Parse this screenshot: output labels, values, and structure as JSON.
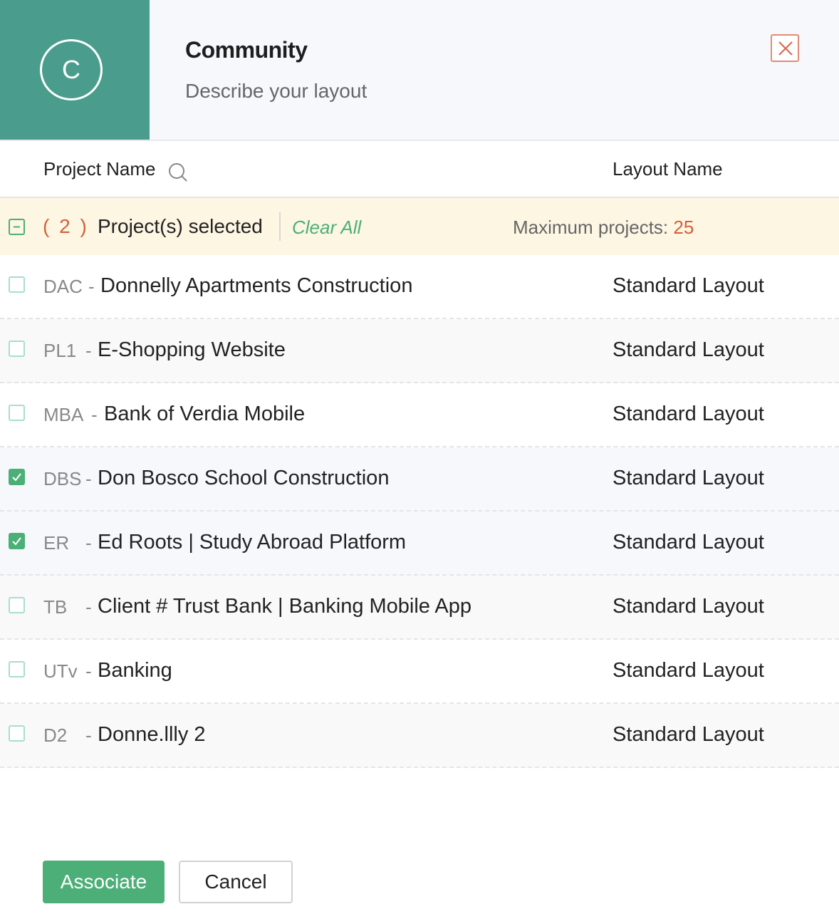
{
  "dialog": {
    "avatar_letter": "C",
    "title": "Community",
    "subtitle": "Describe your layout"
  },
  "columns": {
    "project_name": "Project Name",
    "layout_name": "Layout Name"
  },
  "selection": {
    "count": "( 2 )",
    "label": "Project(s) selected",
    "clear_all": "Clear All",
    "max_label": "Maximum projects: ",
    "max_value": "25"
  },
  "rows": [
    {
      "code": "DAC",
      "name": "Donnelly Apartments Construction",
      "layout": "Standard Layout",
      "checked": false
    },
    {
      "code": "PL1",
      "name": "E-Shopping Website",
      "layout": "Standard Layout",
      "checked": false
    },
    {
      "code": "MBA",
      "name": "Bank of Verdia Mobile",
      "layout": "Standard Layout",
      "checked": false
    },
    {
      "code": "DBS",
      "name": "Don Bosco School Construction",
      "layout": "Standard Layout",
      "checked": true
    },
    {
      "code": "ER",
      "name": "Ed Roots | Study Abroad Platform",
      "layout": "Standard Layout",
      "checked": true
    },
    {
      "code": "TB",
      "name": "Client # Trust Bank | Banking Mobile App",
      "layout": "Standard Layout",
      "checked": false
    },
    {
      "code": "UTv",
      "name": "Banking",
      "layout": "Standard Layout",
      "checked": false
    },
    {
      "code": "D2",
      "name": "Donne.llly 2",
      "layout": "Standard Layout",
      "checked": false
    }
  ],
  "dash": "-",
  "footer": {
    "associate_label": "Associate",
    "cancel_label": "Cancel"
  },
  "colors": {
    "accent": "#4a9d8d",
    "primary_button": "#4caf78",
    "count_highlight": "#d4603c"
  }
}
